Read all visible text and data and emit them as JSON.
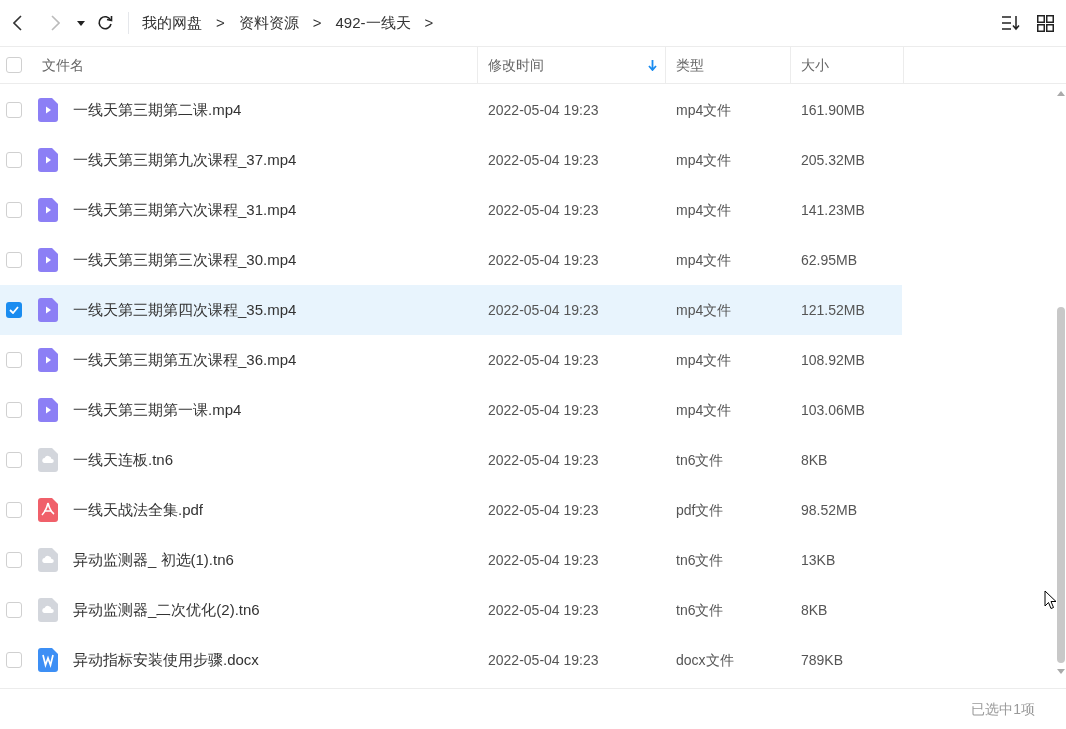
{
  "breadcrumb": [
    "我的网盘",
    "资料资源",
    "492-一线天"
  ],
  "breadcrumb_separator": ">",
  "table": {
    "columns": [
      {
        "label": "文件名",
        "sorted": false
      },
      {
        "label": "修改时间",
        "sorted": true
      },
      {
        "label": "类型",
        "sorted": false
      },
      {
        "label": "大小",
        "sorted": false
      }
    ],
    "select_all_checked": false,
    "rows": [
      {
        "name": "一线天第三期第二课.mp4",
        "kind": "video",
        "modified": "2022-05-04 19:23",
        "type": "mp4文件",
        "size": "161.90MB",
        "selected": false
      },
      {
        "name": "一线天第三期第九次课程_37.mp4",
        "kind": "video",
        "modified": "2022-05-04 19:23",
        "type": "mp4文件",
        "size": "205.32MB",
        "selected": false
      },
      {
        "name": "一线天第三期第六次课程_31.mp4",
        "kind": "video",
        "modified": "2022-05-04 19:23",
        "type": "mp4文件",
        "size": "141.23MB",
        "selected": false
      },
      {
        "name": "一线天第三期第三次课程_30.mp4",
        "kind": "video",
        "modified": "2022-05-04 19:23",
        "type": "mp4文件",
        "size": "62.95MB",
        "selected": false
      },
      {
        "name": "一线天第三期第四次课程_35.mp4",
        "kind": "video",
        "modified": "2022-05-04 19:23",
        "type": "mp4文件",
        "size": "121.52MB",
        "selected": true
      },
      {
        "name": "一线天第三期第五次课程_36.mp4",
        "kind": "video",
        "modified": "2022-05-04 19:23",
        "type": "mp4文件",
        "size": "108.92MB",
        "selected": false
      },
      {
        "name": "一线天第三期第一课.mp4",
        "kind": "video",
        "modified": "2022-05-04 19:23",
        "type": "mp4文件",
        "size": "103.06MB",
        "selected": false
      },
      {
        "name": "一线天连板.tn6",
        "kind": "generic",
        "modified": "2022-05-04 19:23",
        "type": "tn6文件",
        "size": "8KB",
        "selected": false
      },
      {
        "name": "一线天战法全集.pdf",
        "kind": "pdf",
        "modified": "2022-05-04 19:23",
        "type": "pdf文件",
        "size": "98.52MB",
        "selected": false
      },
      {
        "name": "异动监测器_ 初选(1).tn6",
        "kind": "generic",
        "modified": "2022-05-04 19:23",
        "type": "tn6文件",
        "size": "13KB",
        "selected": false
      },
      {
        "name": "异动监测器_二次优化(2).tn6",
        "kind": "generic",
        "modified": "2022-05-04 19:23",
        "type": "tn6文件",
        "size": "8KB",
        "selected": false
      },
      {
        "name": "异动指标安装使用步骤.docx",
        "kind": "docx",
        "modified": "2022-05-04 19:23",
        "type": "docx文件",
        "size": "789KB",
        "selected": false
      }
    ]
  },
  "status_bar": "已选中1项"
}
